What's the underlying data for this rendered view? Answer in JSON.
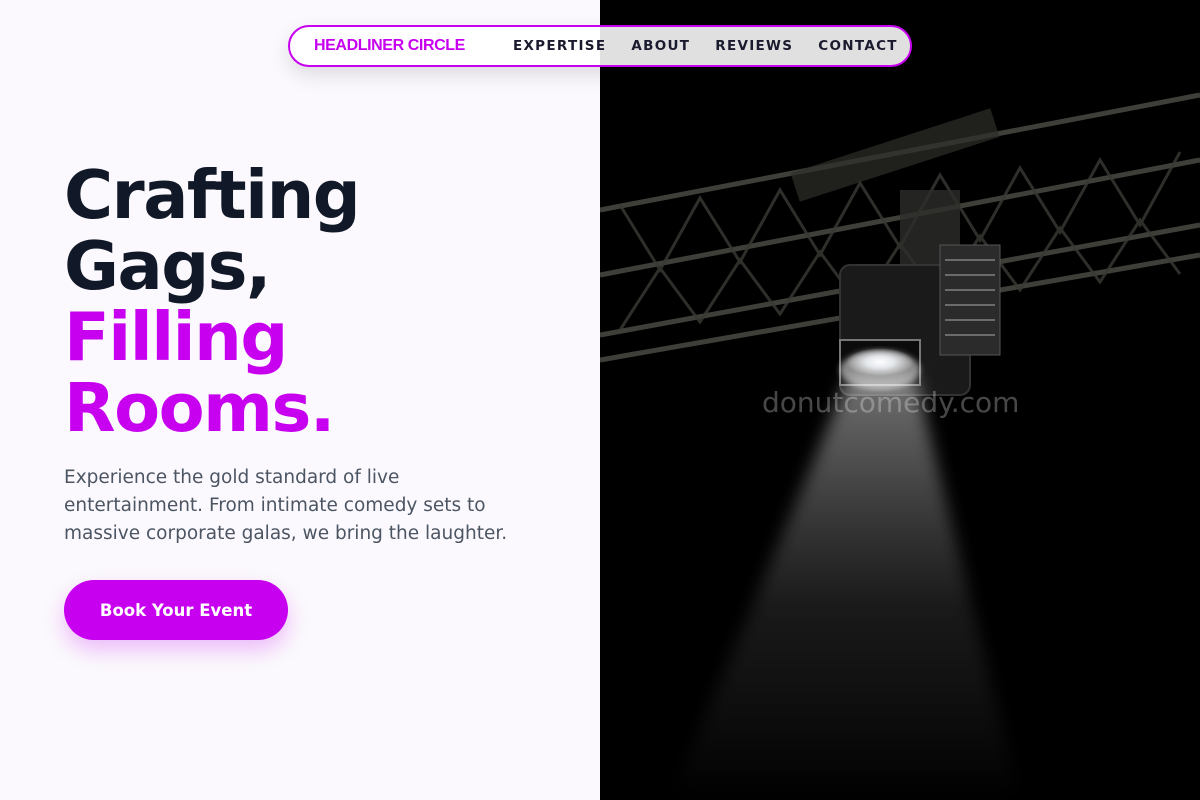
{
  "nav": {
    "brand": "HEADLINER CIRCLE",
    "links": [
      "EXPERTISE",
      "ABOUT",
      "REVIEWS",
      "CONTACT"
    ]
  },
  "hero": {
    "headline_line1": "Crafting",
    "headline_line2": "Gags,",
    "headline_accent_line1": "Filling",
    "headline_accent_line2": "Rooms.",
    "description": "Experience the gold standard of live entertainment. From intimate comedy sets to massive corporate galas, we bring the laughter.",
    "cta_label": "Book Your Event"
  },
  "image": {
    "watermark": "donutcomedy.com",
    "subject": "stage-spotlight-on-truss"
  },
  "colors": {
    "accent": "#c800f0",
    "heading": "#111827",
    "body_text": "#4b5563",
    "background": "#fbf9fd"
  }
}
